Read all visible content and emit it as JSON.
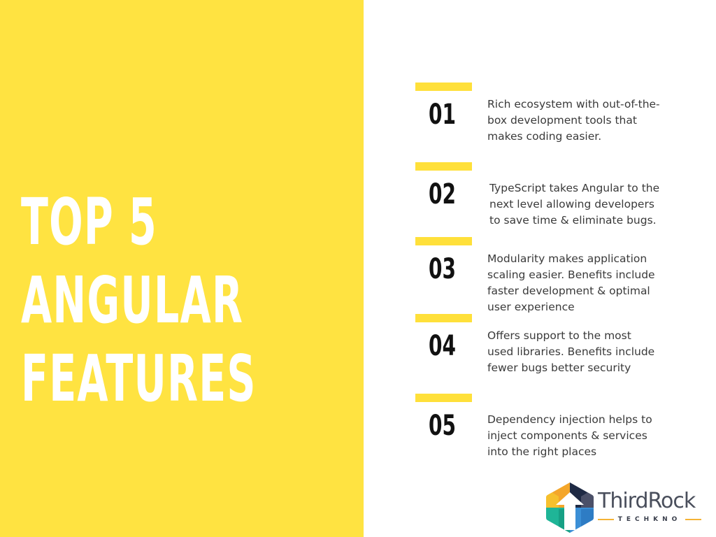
{
  "colors": {
    "panel_yellow": "#ffe341",
    "bar_yellow": "#ffe03a",
    "headline_text": "#ffffff",
    "number_text": "#111111",
    "body_text": "#3a3a3a"
  },
  "headline": {
    "lines": [
      "TOP 5",
      "ANGULAR",
      "FEATURES"
    ]
  },
  "features": [
    {
      "number": "01",
      "lines": [
        "Rich ecosystem with out-of-the-",
        "box development tools that",
        "makes coding easier."
      ]
    },
    {
      "number": "02",
      "lines": [
        "TypeScript takes Angular to the",
        "next level allowing developers",
        "to save time & eliminate bugs."
      ]
    },
    {
      "number": "03",
      "lines": [
        "Modularity makes application",
        "scaling easier. Benefits include",
        "faster development & optimal",
        "user experience"
      ]
    },
    {
      "number": "04",
      "lines": [
        "Offers support to the most",
        "used libraries. Benefits include",
        "fewer bugs better security"
      ]
    },
    {
      "number": "05",
      "lines": [
        "Dependency injection helps to",
        "inject components & services",
        "into the right places"
      ]
    }
  ],
  "logo": {
    "name": "ThirdRock",
    "tagline": "TECHKNO",
    "icon": "hexagon-arrow-logo-icon"
  }
}
